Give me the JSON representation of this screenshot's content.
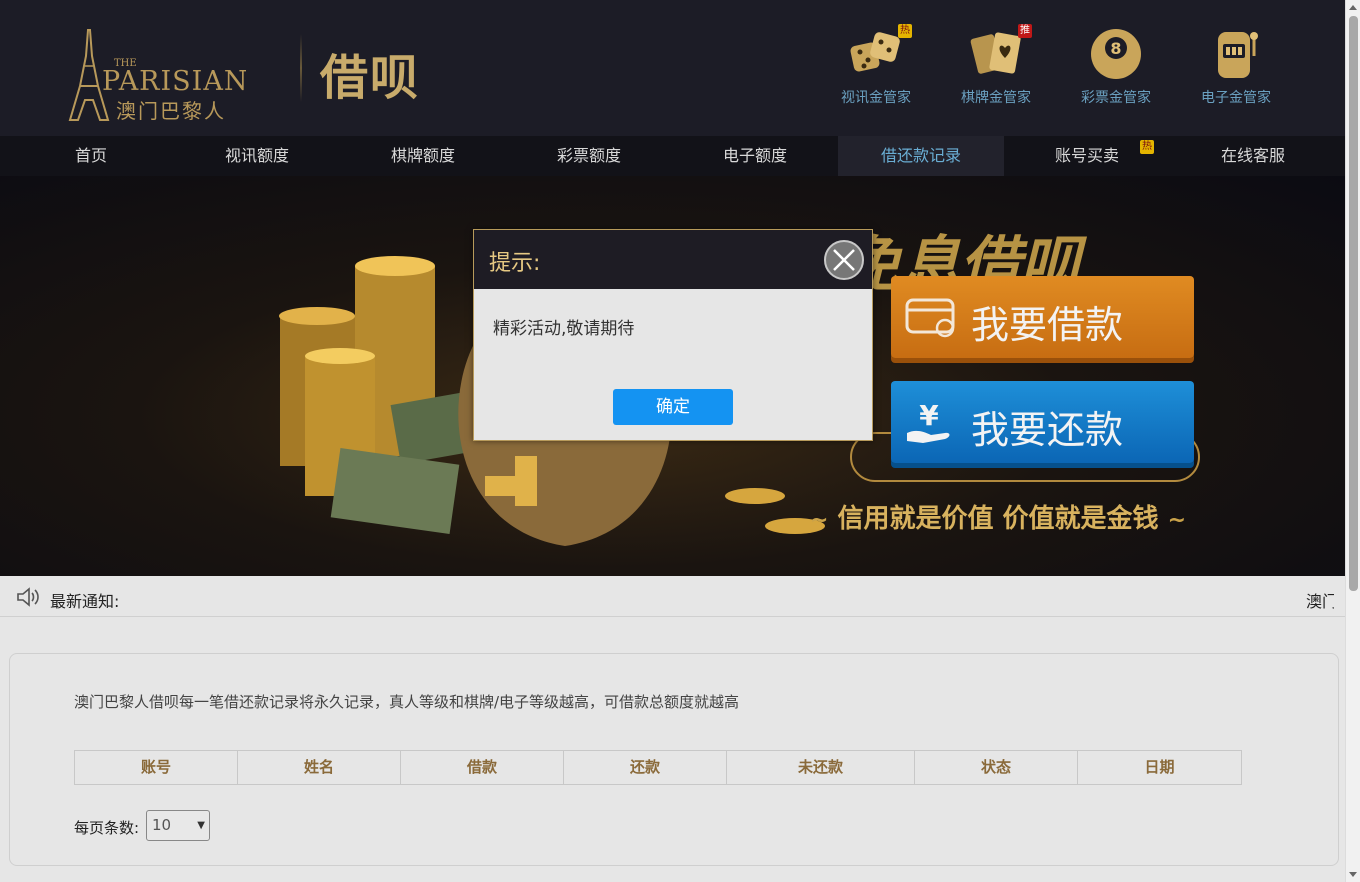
{
  "header": {
    "logo_text_top": "THE",
    "logo_text_main": "PARISIAN",
    "logo_text_cn": "澳门巴黎人",
    "brand_title": "借呗",
    "managers": [
      {
        "label": "视讯金管家",
        "badge": "热",
        "icon": "dice-icon"
      },
      {
        "label": "棋牌金管家",
        "badge": "推",
        "icon": "cards-icon"
      },
      {
        "label": "彩票金管家",
        "badge": "",
        "icon": "lottery-ball-icon"
      },
      {
        "label": "电子金管家",
        "badge": "",
        "icon": "slot-machine-icon"
      }
    ]
  },
  "nav": {
    "items": [
      {
        "label": "首页"
      },
      {
        "label": "视讯额度"
      },
      {
        "label": "棋牌额度"
      },
      {
        "label": "彩票额度"
      },
      {
        "label": "电子额度"
      },
      {
        "label": "借还款记录"
      },
      {
        "label": "账号买卖",
        "badge": "热"
      },
      {
        "label": "在线客服"
      }
    ],
    "active_index": 5
  },
  "banner": {
    "headline": "免息借呗",
    "borrow_button": "我要借款",
    "repay_button": "我要还款",
    "slogan": "信用就是价值 价值就是金钱"
  },
  "notice": {
    "label": "最新通知:",
    "marquee_text": "澳门"
  },
  "records": {
    "intro": "澳门巴黎人借呗每一笔借还款记录将永久记录，真人等级和棋牌/电子等级越高，可借款总额度就越高",
    "columns": [
      "账号",
      "姓名",
      "借款",
      "还款",
      "未还款",
      "状态",
      "日期"
    ],
    "per_page_label": "每页条数:",
    "per_page_value": "10"
  },
  "modal": {
    "title": "提示:",
    "message": "精彩活动,敬请期待",
    "ok_label": "确定"
  },
  "colors": {
    "header_bg": "#1c1c26",
    "gold": "#c8ab6b",
    "nav_active": "#6aaed4",
    "borrow": "#e08b22",
    "repay": "#1e8fd8",
    "ok_button": "#1493f2"
  }
}
